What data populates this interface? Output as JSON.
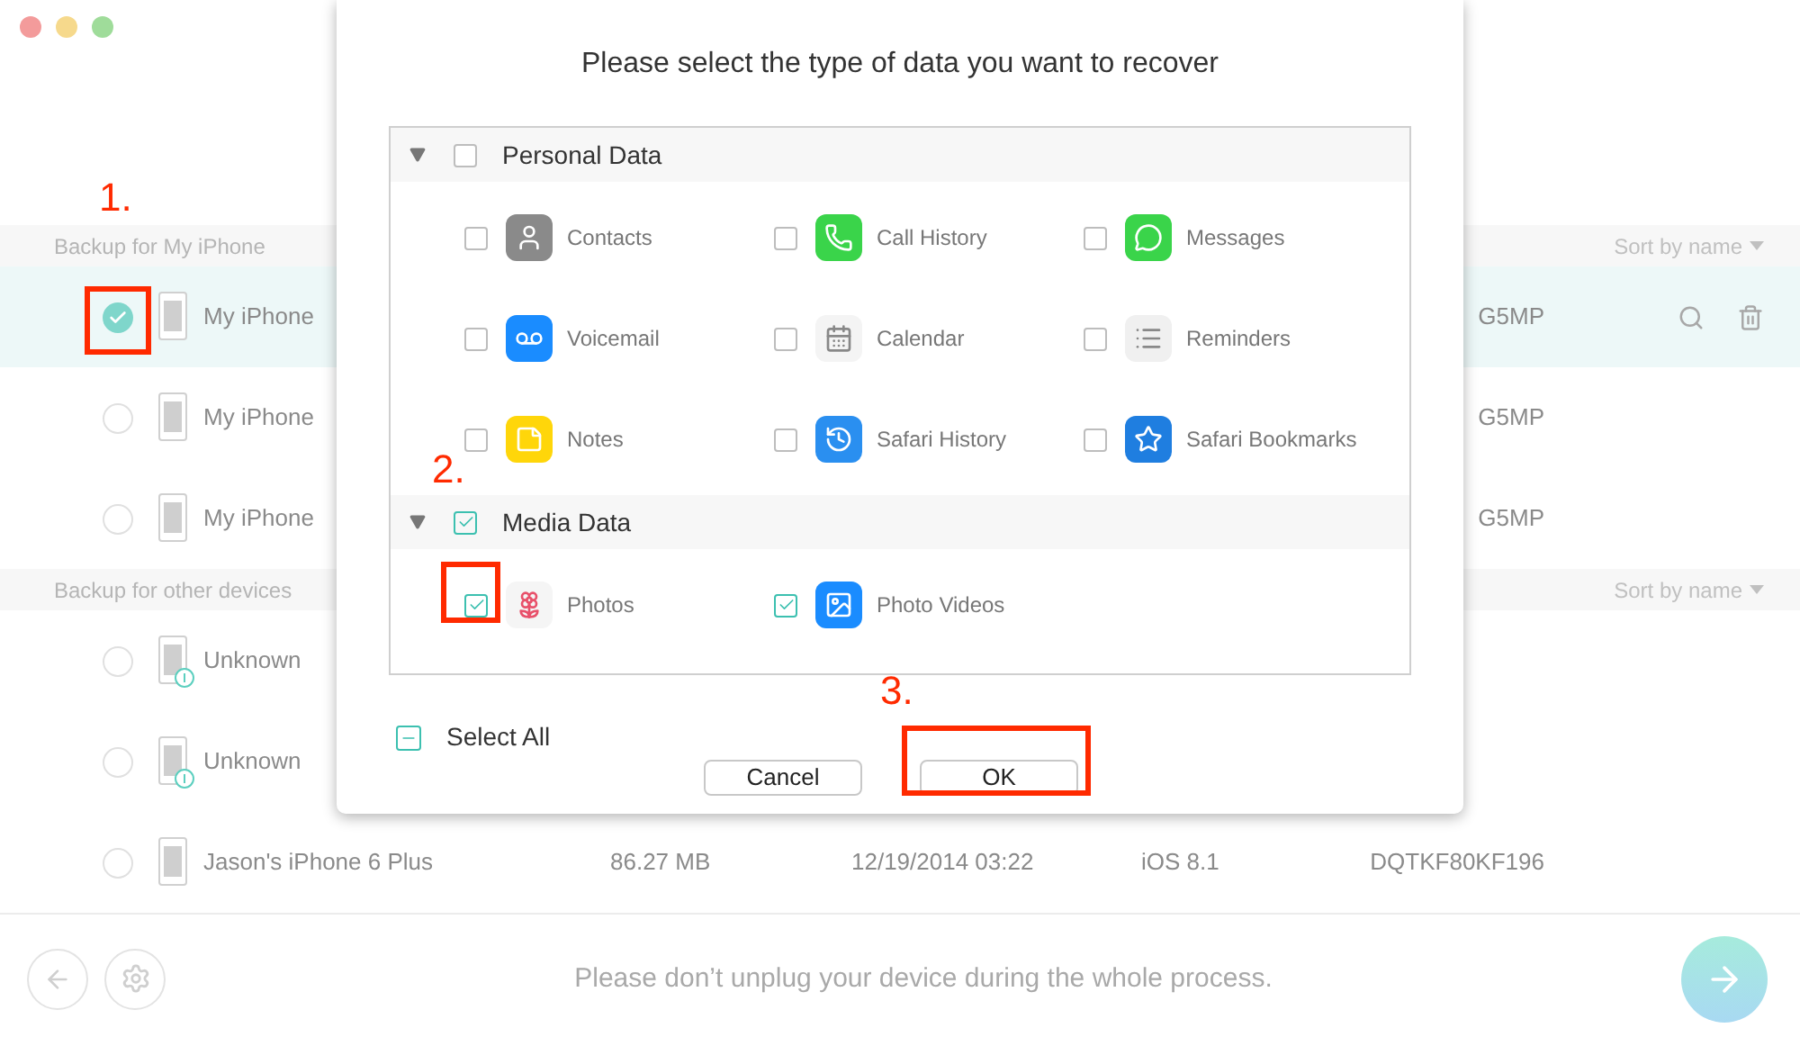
{
  "backup_groups": [
    {
      "title": "Backup for My iPhone",
      "sort": "Sort by name",
      "rows": [
        {
          "name": "My iPhone",
          "serial": "G5MP",
          "selected": true,
          "warning": false
        },
        {
          "name": "My iPhone",
          "serial": "G5MP",
          "selected": false,
          "warning": false
        },
        {
          "name": "My iPhone",
          "serial": "G5MP",
          "selected": false,
          "warning": false
        }
      ]
    },
    {
      "title": "Backup for other devices",
      "sort": "Sort by name",
      "rows": [
        {
          "name": "Unknown",
          "selected": false,
          "warning": true
        },
        {
          "name": "Unknown",
          "selected": false,
          "warning": true
        },
        {
          "name": "Jason's iPhone 6 Plus",
          "size": "86.27 MB",
          "date": "12/19/2014 03:22",
          "ios": "iOS 8.1",
          "serial": "DQTKF80KF196",
          "selected": false,
          "warning": false
        }
      ]
    }
  ],
  "footer": {
    "message": "Please don’t unplug your device during the whole process."
  },
  "dialog": {
    "title": "Please select the type of data you want to recover",
    "sections": [
      {
        "title": "Personal Data",
        "checked": false,
        "expanded": true,
        "items": [
          {
            "label": "Contacts",
            "checked": false
          },
          {
            "label": "Call History",
            "checked": false
          },
          {
            "label": "Messages",
            "checked": false
          },
          {
            "label": "Voicemail",
            "checked": false
          },
          {
            "label": "Calendar",
            "checked": false
          },
          {
            "label": "Reminders",
            "checked": false
          },
          {
            "label": "Notes",
            "checked": false
          },
          {
            "label": "Safari History",
            "checked": false
          },
          {
            "label": "Safari Bookmarks",
            "checked": false
          }
        ]
      },
      {
        "title": "Media Data",
        "checked": true,
        "expanded": true,
        "items": [
          {
            "label": "Photos",
            "checked": true
          },
          {
            "label": "Photo Videos",
            "checked": true
          }
        ]
      }
    ],
    "select_all": {
      "label": "Select All",
      "partial": true
    },
    "buttons": [
      "Cancel",
      "OK"
    ]
  },
  "annotations": [
    {
      "label": "1."
    },
    {
      "label": "2."
    },
    {
      "label": "3."
    }
  ]
}
